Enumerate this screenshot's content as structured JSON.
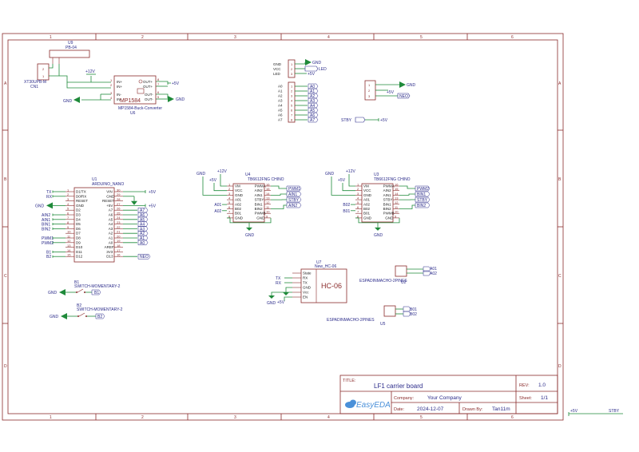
{
  "title_block": {
    "title_label": "TITLE:",
    "title": "LF1 carrier board",
    "rev_label": "REV:",
    "rev": "1.0",
    "company_label": "Company:",
    "company": "Your Company",
    "sheet_label": "Sheet:",
    "sheet": "1/1",
    "date_label": "Date:",
    "date": "2024-12-07",
    "drawn_label": "Drawn By:",
    "drawn": "Tan11m",
    "brand": "EasyEDA"
  },
  "rulers": {
    "cols": [
      "1",
      "2",
      "3",
      "4",
      "5",
      "6"
    ],
    "rows": [
      "A",
      "B",
      "C",
      "D"
    ]
  },
  "u9": {
    "ref": "U9",
    "name": "PB-04"
  },
  "cn1": {
    "ref": "CN1",
    "name": "XT30UPB-M",
    "pins": [
      "2",
      "1"
    ]
  },
  "u6": {
    "ref": "U6",
    "name": "MP1584-Buck-Converter",
    "chip": "MP1584",
    "pins_left": [
      "IN+",
      "IN+",
      "IN-",
      "IN-"
    ],
    "pins_right": [
      "OUT+",
      "OUT+",
      "OUT-",
      "OUT-"
    ],
    "pinnum_left": [
      "1",
      "2",
      "3",
      "4"
    ],
    "pinnum_right": [
      "8",
      "7",
      "6",
      "5"
    ]
  },
  "header_a": {
    "top_labels": [
      "GND",
      "VCC",
      "LED"
    ],
    "top_pins": [
      "1",
      "2",
      "3"
    ],
    "labels": [
      "A0",
      "A1",
      "A2",
      "A3",
      "A4",
      "A5",
      "A6",
      "A7"
    ],
    "pins": [
      "1",
      "2",
      "3",
      "4",
      "5",
      "6",
      "7",
      "8"
    ],
    "nets": [
      "A0",
      "A1",
      "A2",
      "A3",
      "A4",
      "A5",
      "A6",
      "A7"
    ]
  },
  "header_neo": {
    "pins": [
      "1",
      "2",
      "3"
    ],
    "net": "NEO"
  },
  "u1": {
    "ref": "U1",
    "name": "ARDUINO_NANO",
    "left": [
      "D1/TX",
      "D0/RX",
      "RESET",
      "GND",
      "D2",
      "D3",
      "D4",
      "D5",
      "D6",
      "D7",
      "D8",
      "D9",
      "D10",
      "D11",
      "D12"
    ],
    "left_num": [
      "1",
      "2",
      "3",
      "4",
      "5",
      "6",
      "7",
      "8",
      "9",
      "10",
      "11",
      "12",
      "13",
      "14",
      "15"
    ],
    "right": [
      "VIN",
      "GND",
      "RESET",
      "+5V",
      "A7",
      "A6",
      "A5",
      "A4",
      "A3",
      "A2",
      "A1",
      "A0",
      "AREF",
      "3V3",
      "D13"
    ],
    "right_num": [
      "30",
      "29",
      "28",
      "27",
      "26",
      "25",
      "24",
      "23",
      "22",
      "21",
      "20",
      "19",
      "18",
      "17",
      "16"
    ],
    "left_nets": [
      "TX",
      "RX",
      "",
      "GND",
      "",
      "AIN2",
      "AIN1",
      "BIN1",
      "BIN2",
      "",
      "PWM1",
      "PWM2",
      "",
      "B1",
      "B2"
    ],
    "right_nets": [
      "+5V",
      "",
      "",
      "+5V",
      "A7",
      "A6",
      "A5",
      "A4",
      "A3",
      "A2",
      "A1",
      "A0",
      "",
      "",
      "NEO"
    ]
  },
  "u4": {
    "ref": "U4",
    "name": "TB6612FNG CHINO",
    "left": [
      "VM",
      "VCC",
      "GND",
      "A01",
      "A02",
      "B02",
      "B01",
      "GND"
    ],
    "right": [
      "PWMA",
      "AIN2",
      "AIN1",
      "STBY",
      "BIN1",
      "BIN2",
      "PWMB",
      "GND"
    ],
    "left_num": [
      "1",
      "2",
      "3",
      "4",
      "5",
      "6",
      "7",
      "8"
    ],
    "right_num": [
      "16",
      "15",
      "14",
      "13",
      "12",
      "11",
      "10",
      "9"
    ],
    "nets_right": [
      "PWM1",
      "AIN1",
      "STBY",
      "AIN2"
    ],
    "nets_left": [
      "A01",
      "A02"
    ]
  },
  "u3": {
    "ref": "U3",
    "name": "TB6612FNG CHINO",
    "left": [
      "VM",
      "VCC",
      "GND",
      "A01",
      "A02",
      "B02",
      "B01",
      "GND"
    ],
    "right": [
      "PWMA",
      "AIN2",
      "AIN1",
      "STBY",
      "BIN1",
      "BIN2",
      "PWMB",
      "GND"
    ],
    "left_num": [
      "1",
      "2",
      "3",
      "4",
      "5",
      "6",
      "7",
      "8"
    ],
    "right_num": [
      "16",
      "15",
      "14",
      "13",
      "12",
      "11",
      "10",
      "9"
    ],
    "nets_right": [
      "PWM2",
      "BIN1",
      "STBY",
      "BIN2"
    ],
    "nets_left": [
      "B02",
      "B01"
    ]
  },
  "u7": {
    "ref": "U7",
    "name": "New_HC-06",
    "chip": "HC-06",
    "pins": [
      "State",
      "RX",
      "TX",
      "GND",
      "Vcc",
      "EN"
    ],
    "nets": [
      "TX",
      "RX"
    ]
  },
  "u2": {
    "ref": "U2",
    "name": "ESPADINMACHO-2PINES",
    "nets": [
      "A01",
      "A02"
    ]
  },
  "u5": {
    "ref": "U5",
    "name": "ESPADINMACHO-2PINES",
    "nets": [
      "B01",
      "B02"
    ]
  },
  "b1": {
    "ref": "B1",
    "name": "SWITCH-MOMENTARY-2",
    "net": "B1"
  },
  "b2": {
    "ref": "B2",
    "name": "SWITCH-MOMENTARY-2",
    "net": "B2"
  },
  "nets": {
    "gnd": "GND",
    "p5v": "+5V",
    "p12v": "+12V",
    "stby": "STBY",
    "led": "LED",
    "neo": "NEO"
  },
  "colors": {
    "border": "#8a2b2b",
    "wire": "#1f8a3a",
    "part": "#8a2b2b",
    "label": "#2b2b8a"
  }
}
